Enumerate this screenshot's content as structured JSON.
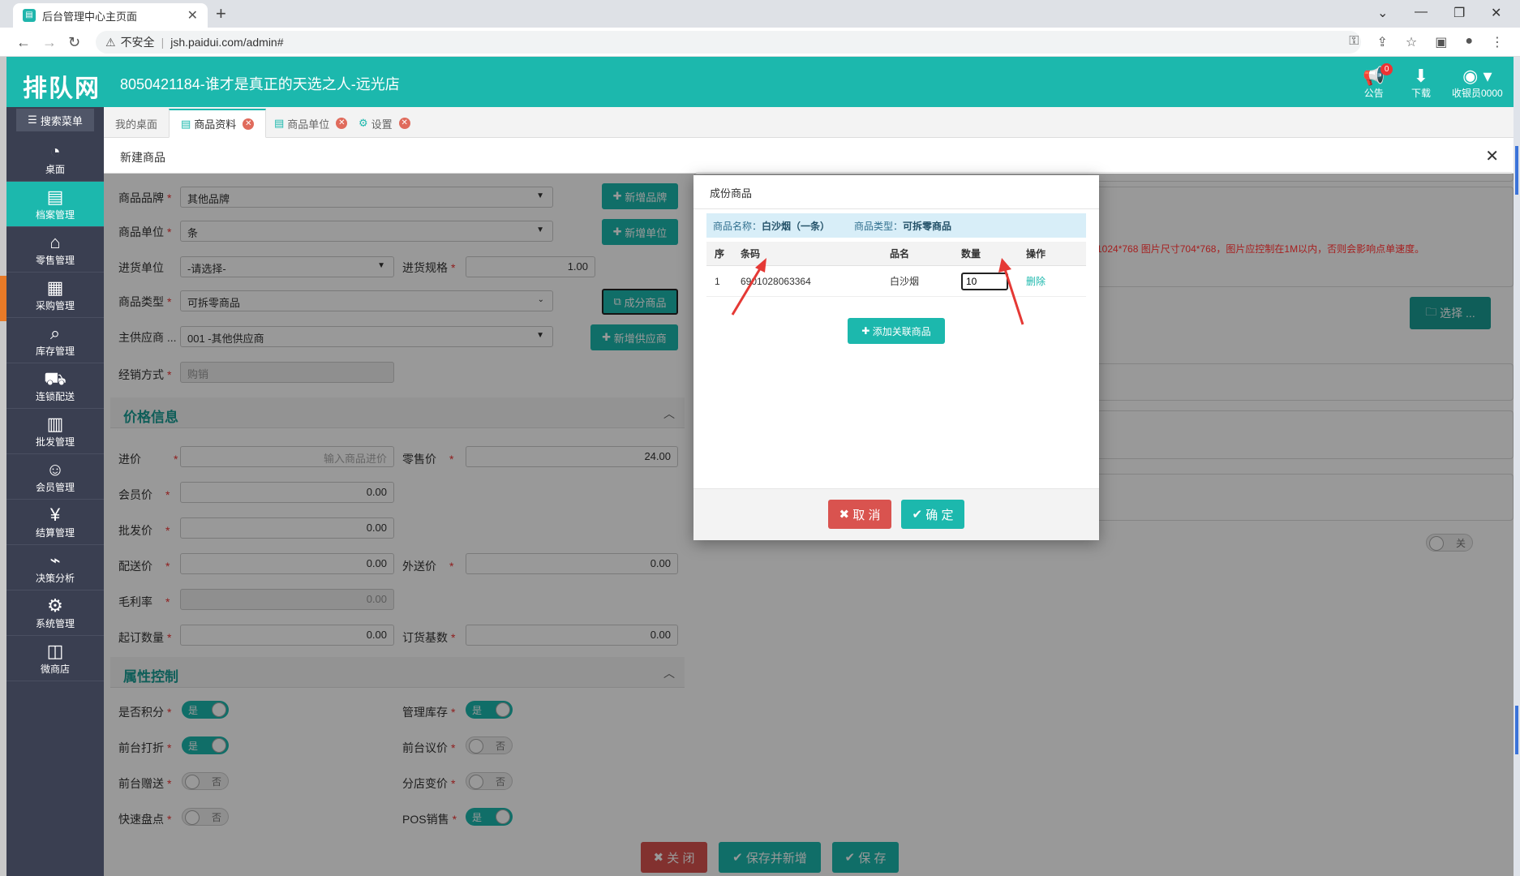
{
  "browser": {
    "tab_title": "后台管理中心主页面",
    "url_warning": "不安全",
    "url": "jsh.paidui.com/admin#"
  },
  "header": {
    "logo": "排队网",
    "store_name": "8050421184-谁才是真正的天选之人-远光店",
    "notice_label": "公告",
    "notice_count": "0",
    "download_label": "下载",
    "user_label": "收银员0000"
  },
  "sidebar": {
    "search_label": "搜索菜单",
    "items": [
      {
        "label": "桌面",
        "icon": "dashboard-icon"
      },
      {
        "label": "档案管理",
        "icon": "archive-icon"
      },
      {
        "label": "零售管理",
        "icon": "store-icon"
      },
      {
        "label": "采购管理",
        "icon": "purchase-icon"
      },
      {
        "label": "库存管理",
        "icon": "inventory-icon"
      },
      {
        "label": "连锁配送",
        "icon": "delivery-icon"
      },
      {
        "label": "批发管理",
        "icon": "wholesale-icon"
      },
      {
        "label": "会员管理",
        "icon": "member-icon"
      },
      {
        "label": "结算管理",
        "icon": "settlement-icon"
      },
      {
        "label": "决策分析",
        "icon": "chart-icon"
      },
      {
        "label": "系统管理",
        "icon": "settings-icon"
      },
      {
        "label": "微商店",
        "icon": "shop-bag-icon"
      }
    ]
  },
  "tabs": [
    {
      "label": "我的桌面"
    },
    {
      "label": "商品资料"
    },
    {
      "label": "商品单位"
    },
    {
      "label": "设置"
    }
  ],
  "page": {
    "title": "新建商品"
  },
  "form": {
    "brand_label": "商品品牌",
    "brand_value": "其他品牌",
    "add_brand": "新增品牌",
    "unit_label": "商品单位",
    "unit_value": "条",
    "add_unit": "新增单位",
    "purchase_unit_label": "进货单位",
    "purchase_unit_value": "-请选择-",
    "purchase_spec_label": "进货规格",
    "purchase_spec_value": "1.00",
    "type_label": "商品类型",
    "type_value": "可拆零商品",
    "component_btn": "成分商品",
    "supplier_label": "主供应商 ...",
    "supplier_value": "001 -其他供应商",
    "add_supplier": "新增供应商",
    "sale_mode_label": "经销方式",
    "sale_mode_value": "购销",
    "price_section": "价格信息",
    "cost_label": "进价",
    "cost_placeholder": "输入商品进价",
    "retail_label": "零售价",
    "retail_value": "24.00",
    "member_label": "会员价",
    "member_value": "0.00",
    "wholesale_label": "批发价",
    "wholesale_value": "0.00",
    "dist_label": "配送价",
    "dist_value": "0.00",
    "ext_label": "外送价",
    "ext_value": "0.00",
    "margin_label": "毛利率",
    "margin_value": "0.00",
    "min_order_label": "起订数量",
    "min_order_value": "0.00",
    "order_base_label": "订货基数",
    "order_base_value": "0.00",
    "attr_section": "属性控制",
    "points_label": "是否积分",
    "stock_label": "管理库存",
    "discount_label": "前台打折",
    "bargain_label": "前台议价",
    "gift_label": "前台赠送",
    "branch_price_label": "分店变价",
    "quick_count_label": "快速盘点",
    "pos_label": "POS销售",
    "yes": "是",
    "no": "否",
    "off": "关"
  },
  "right": {
    "choose_btn": "选择 ...",
    "hint": "1024*768 图片尺寸704*768，图片应控制在1M以内，否则会影响点单速度。"
  },
  "bottom": {
    "close": "关 闭",
    "save_new": "保存并新增",
    "save": "保 存"
  },
  "modal": {
    "title": "成份商品",
    "info_name_label": "商品名称：",
    "info_name_value": "白沙烟（一条）",
    "info_type_label": "商品类型：",
    "info_type_value": "可拆零商品",
    "col_seq": "序",
    "col_barcode": "条码",
    "col_name": "品名",
    "col_qty": "数量",
    "col_action": "操作",
    "rows": [
      {
        "seq": "1",
        "barcode": "6901028063364",
        "name": "白沙烟",
        "qty": "10",
        "action": "删除"
      }
    ],
    "add_related": "添加关联商品",
    "cancel": "取 消",
    "confirm": "确 定"
  }
}
